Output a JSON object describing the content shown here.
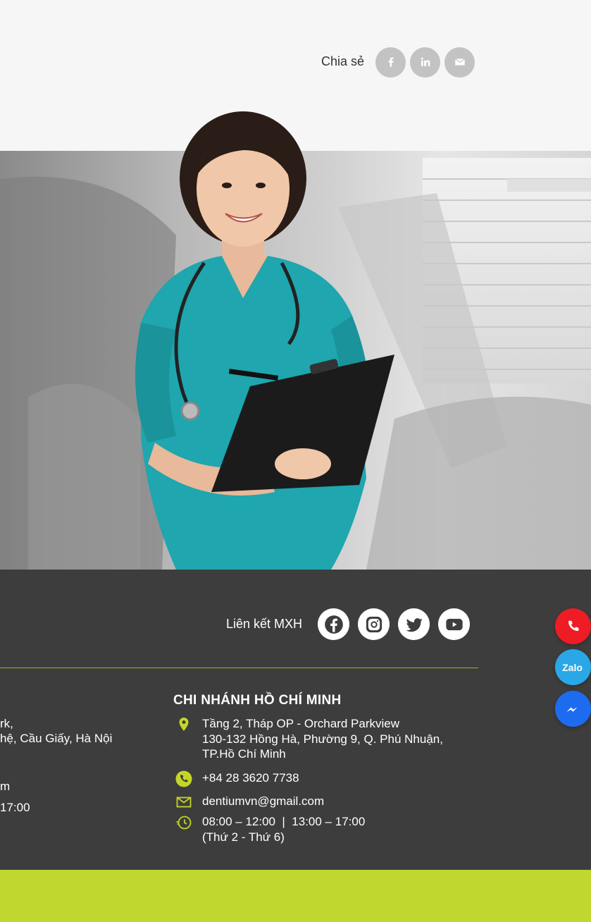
{
  "share": {
    "label": "Chia sẻ",
    "buttons": [
      {
        "icon": "facebook-icon"
      },
      {
        "icon": "linkedin-icon"
      },
      {
        "icon": "email-icon"
      }
    ]
  },
  "footer": {
    "social_label": "Liên kết MXH",
    "social_icons": [
      "facebook-icon",
      "instagram-icon",
      "twitter-icon",
      "youtube-icon"
    ],
    "left_branch": {
      "address_line1": "rk,",
      "address_line2": "hệ, Cầu Giấy, Hà Nội",
      "email_fragment": "m",
      "hours_fragment": "17:00"
    },
    "hcm_branch": {
      "title": "CHI NHÁNH HỒ CHÍ MINH",
      "address_line1": "Tầng 2, Tháp OP - Orchard Parkview",
      "address_line2": "130-132 Hồng Hà, Phường 9, Q. Phú Nhuận,",
      "address_line3": "TP.Hồ Chí Minh",
      "phone": "+84 28 3620 7738",
      "email": "dentiumvn@gmail.com",
      "hours_line1": "08:00 – 12:00  |  13:00 – 17:00",
      "hours_line2": "(Thứ 2 - Thứ 6)"
    }
  },
  "floating": {
    "zalo_label": "Zalo"
  },
  "colors": {
    "accent_green": "#c0d730",
    "divider": "#a4b02a",
    "icon_yellow": "#c5d629",
    "footer_bg": "#3d3d3d",
    "phone_red": "#ee1c25",
    "zalo_blue": "#2aa7e7",
    "messenger_blue": "#1d6cf0"
  }
}
